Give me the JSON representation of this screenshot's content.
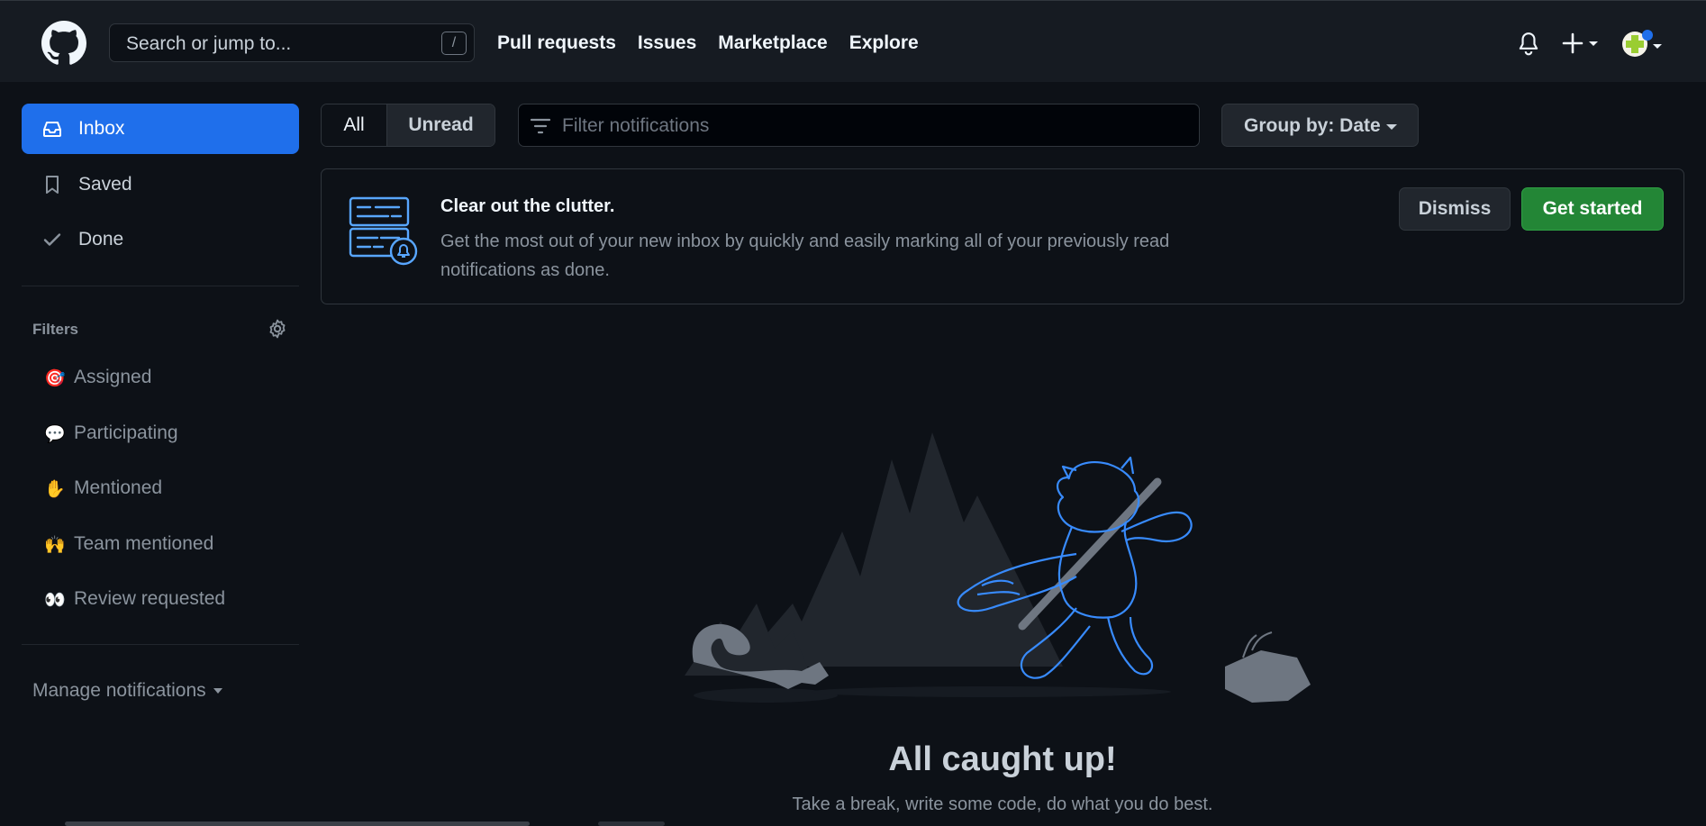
{
  "header": {
    "search_placeholder": "Search or jump to...",
    "search_shortcut": "/",
    "nav": [
      "Pull requests",
      "Issues",
      "Marketplace",
      "Explore"
    ]
  },
  "sidebar": {
    "items": [
      {
        "label": "Inbox",
        "icon": "inbox-icon",
        "active": true
      },
      {
        "label": "Saved",
        "icon": "bookmark-icon",
        "active": false
      },
      {
        "label": "Done",
        "icon": "check-icon",
        "active": false
      }
    ],
    "filters_title": "Filters",
    "filters": [
      {
        "emoji": "🎯",
        "label": "Assigned"
      },
      {
        "emoji": "💬",
        "label": "Participating"
      },
      {
        "emoji": "✋",
        "label": "Mentioned"
      },
      {
        "emoji": "🙌",
        "label": "Team mentioned"
      },
      {
        "emoji": "👀",
        "label": "Review requested"
      }
    ],
    "manage": "Manage notifications"
  },
  "toolbar": {
    "all": "All",
    "unread": "Unread",
    "filter_placeholder": "Filter notifications",
    "group_by": "Group by: Date"
  },
  "banner": {
    "title": "Clear out the clutter.",
    "body": "Get the most out of your new inbox by quickly and easily marking all of your previously read notifications as done.",
    "dismiss": "Dismiss",
    "get_started": "Get started"
  },
  "empty": {
    "title": "All caught up!",
    "subtitle": "Take a break, write some code, do what you do best."
  },
  "colors": {
    "background": "#0d1117",
    "header": "#161b22",
    "accent_blue": "#1f6feb",
    "success_green": "#238636"
  }
}
